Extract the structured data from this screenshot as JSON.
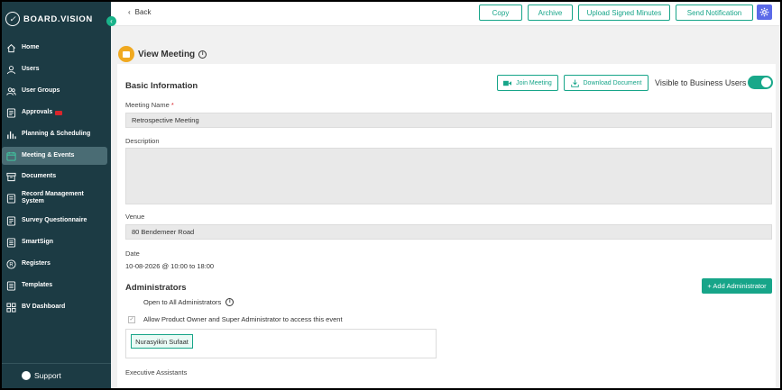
{
  "app": {
    "name": "BOARD.VISION"
  },
  "sidebar": {
    "items": [
      {
        "label": "Home",
        "icon": "home-icon"
      },
      {
        "label": "Users",
        "icon": "user-icon"
      },
      {
        "label": "User Groups",
        "icon": "user-group-icon"
      },
      {
        "label": "Approvals",
        "icon": "approvals-icon"
      },
      {
        "label": "Planning & Scheduling",
        "icon": "bar-chart-icon"
      },
      {
        "label": "Meeting & Events",
        "icon": "calendar-icon"
      },
      {
        "label": "Documents",
        "icon": "archive-box-icon"
      },
      {
        "label": "Record Management System",
        "icon": "record-icon"
      },
      {
        "label": "Survey Questionnaire",
        "icon": "survey-icon"
      },
      {
        "label": "SmartSign",
        "icon": "smartsign-icon"
      },
      {
        "label": "Registers",
        "icon": "registers-icon"
      },
      {
        "label": "Templates",
        "icon": "templates-icon"
      },
      {
        "label": "BV Dashboard",
        "icon": "dashboard-grid-icon"
      }
    ],
    "active": "Meeting & Events",
    "support_label": "Support"
  },
  "topbar": {
    "back_label": "Back",
    "buttons": [
      "Copy",
      "Archive",
      "Upload Signed Minutes",
      "Send Notification"
    ]
  },
  "page": {
    "title": "View Meeting",
    "basic_info_title": "Basic Information",
    "join_meeting_label": "Join Meeting",
    "download_document_label": "Download Document",
    "visible_label": "Visible to Business Users",
    "visible_on": true,
    "meeting_name_label": "Meeting Name",
    "meeting_name_required": "*",
    "meeting_name_value": "Retrospective Meeting",
    "description_label": "Description",
    "description_value": "",
    "venue_label": "Venue",
    "venue_value": "80 Bendemeer Road",
    "date_label": "Date",
    "date_value": "10-08-2026 @ 10:00 to 18:00",
    "administrators_title": "Administrators",
    "add_administrator_label": "+ Add Administrator",
    "open_to_all_label": "Open to All Administrators",
    "allow_label": "Allow Product Owner and Super Administrator to access this event",
    "allow_checked": true,
    "admins": [
      "Nurasyikin Sufaat"
    ],
    "executive_assistants_label": "Executive Assistants"
  },
  "colors": {
    "sidebar_bg": "#1c3b44",
    "accent": "#17a589",
    "settings_button": "#5b6ae8",
    "header_icon": "#f0a920"
  }
}
